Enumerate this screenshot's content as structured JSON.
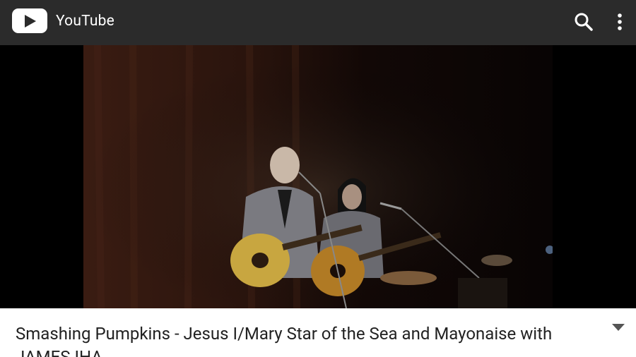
{
  "appbar": {
    "title": "YouTube",
    "background": "#2b2b2b",
    "icons": [
      "youtube-logo-icon",
      "search-icon",
      "more-vert-icon"
    ]
  },
  "player": {
    "background": "#000000"
  },
  "video": {
    "title": "Smashing Pumpkins - Jesus I/Mary Star of the Sea and Mayonaise with JAMES IHA"
  },
  "colors": {
    "text": "#222222",
    "icon": "#ffffff",
    "chevron": "#555555"
  }
}
